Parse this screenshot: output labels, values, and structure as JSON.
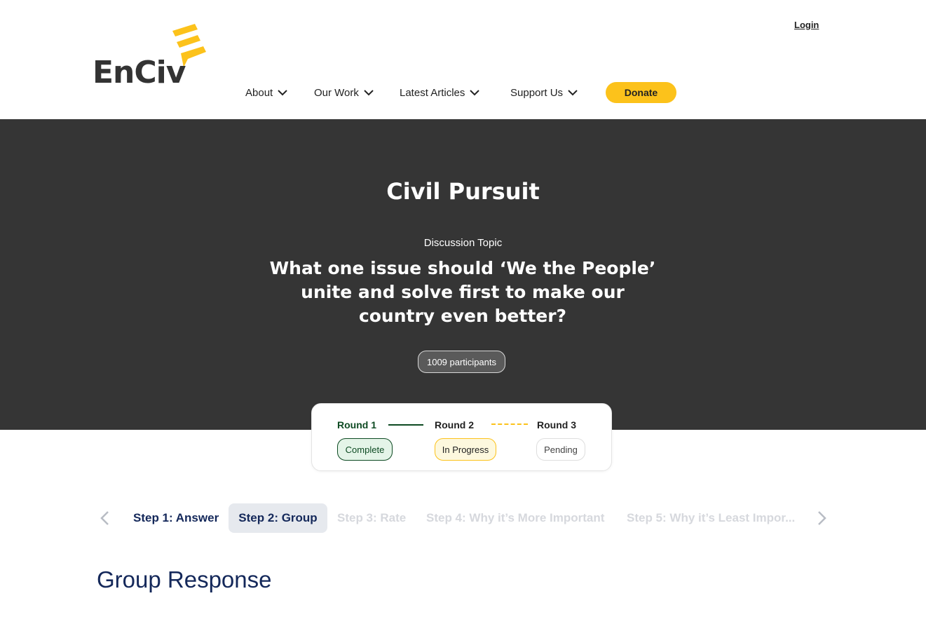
{
  "brand": {
    "name": "EnCiv",
    "accent_color": "#fcc21b",
    "dark_color": "#353535",
    "navy_color": "#14285a",
    "green_color": "#0d4a22"
  },
  "header": {
    "login_label": "Login",
    "nav": [
      {
        "label": "About",
        "icon": "chevron-down-icon"
      },
      {
        "label": "Our Work",
        "icon": "chevron-down-icon"
      },
      {
        "label": "Latest Articles",
        "icon": "chevron-down-icon"
      },
      {
        "label": "Support Us",
        "icon": "chevron-down-icon"
      }
    ],
    "donate_label": "Donate"
  },
  "hero": {
    "title": "Civil Pursuit",
    "topic_label": "Discussion Topic",
    "topic": "What one issue should ‘We the People’ unite and solve first to make our country even better?",
    "participants": "1009 participants"
  },
  "rounds": [
    {
      "label": "Round 1",
      "status": "Complete"
    },
    {
      "label": "Round 2",
      "status": "In Progress"
    },
    {
      "label": "Round 3",
      "status": "Pending"
    }
  ],
  "steps": [
    {
      "label": "Step 1: Answer",
      "state": "done"
    },
    {
      "label": "Step 2: Group",
      "state": "active"
    },
    {
      "label": "Step 3: Rate",
      "state": "disabled"
    },
    {
      "label": "Step 4: Why it’s More Important",
      "state": "disabled"
    },
    {
      "label": "Step 5: Why it’s Least Impor...",
      "state": "disabled"
    }
  ],
  "section": {
    "title": "Group Response"
  }
}
